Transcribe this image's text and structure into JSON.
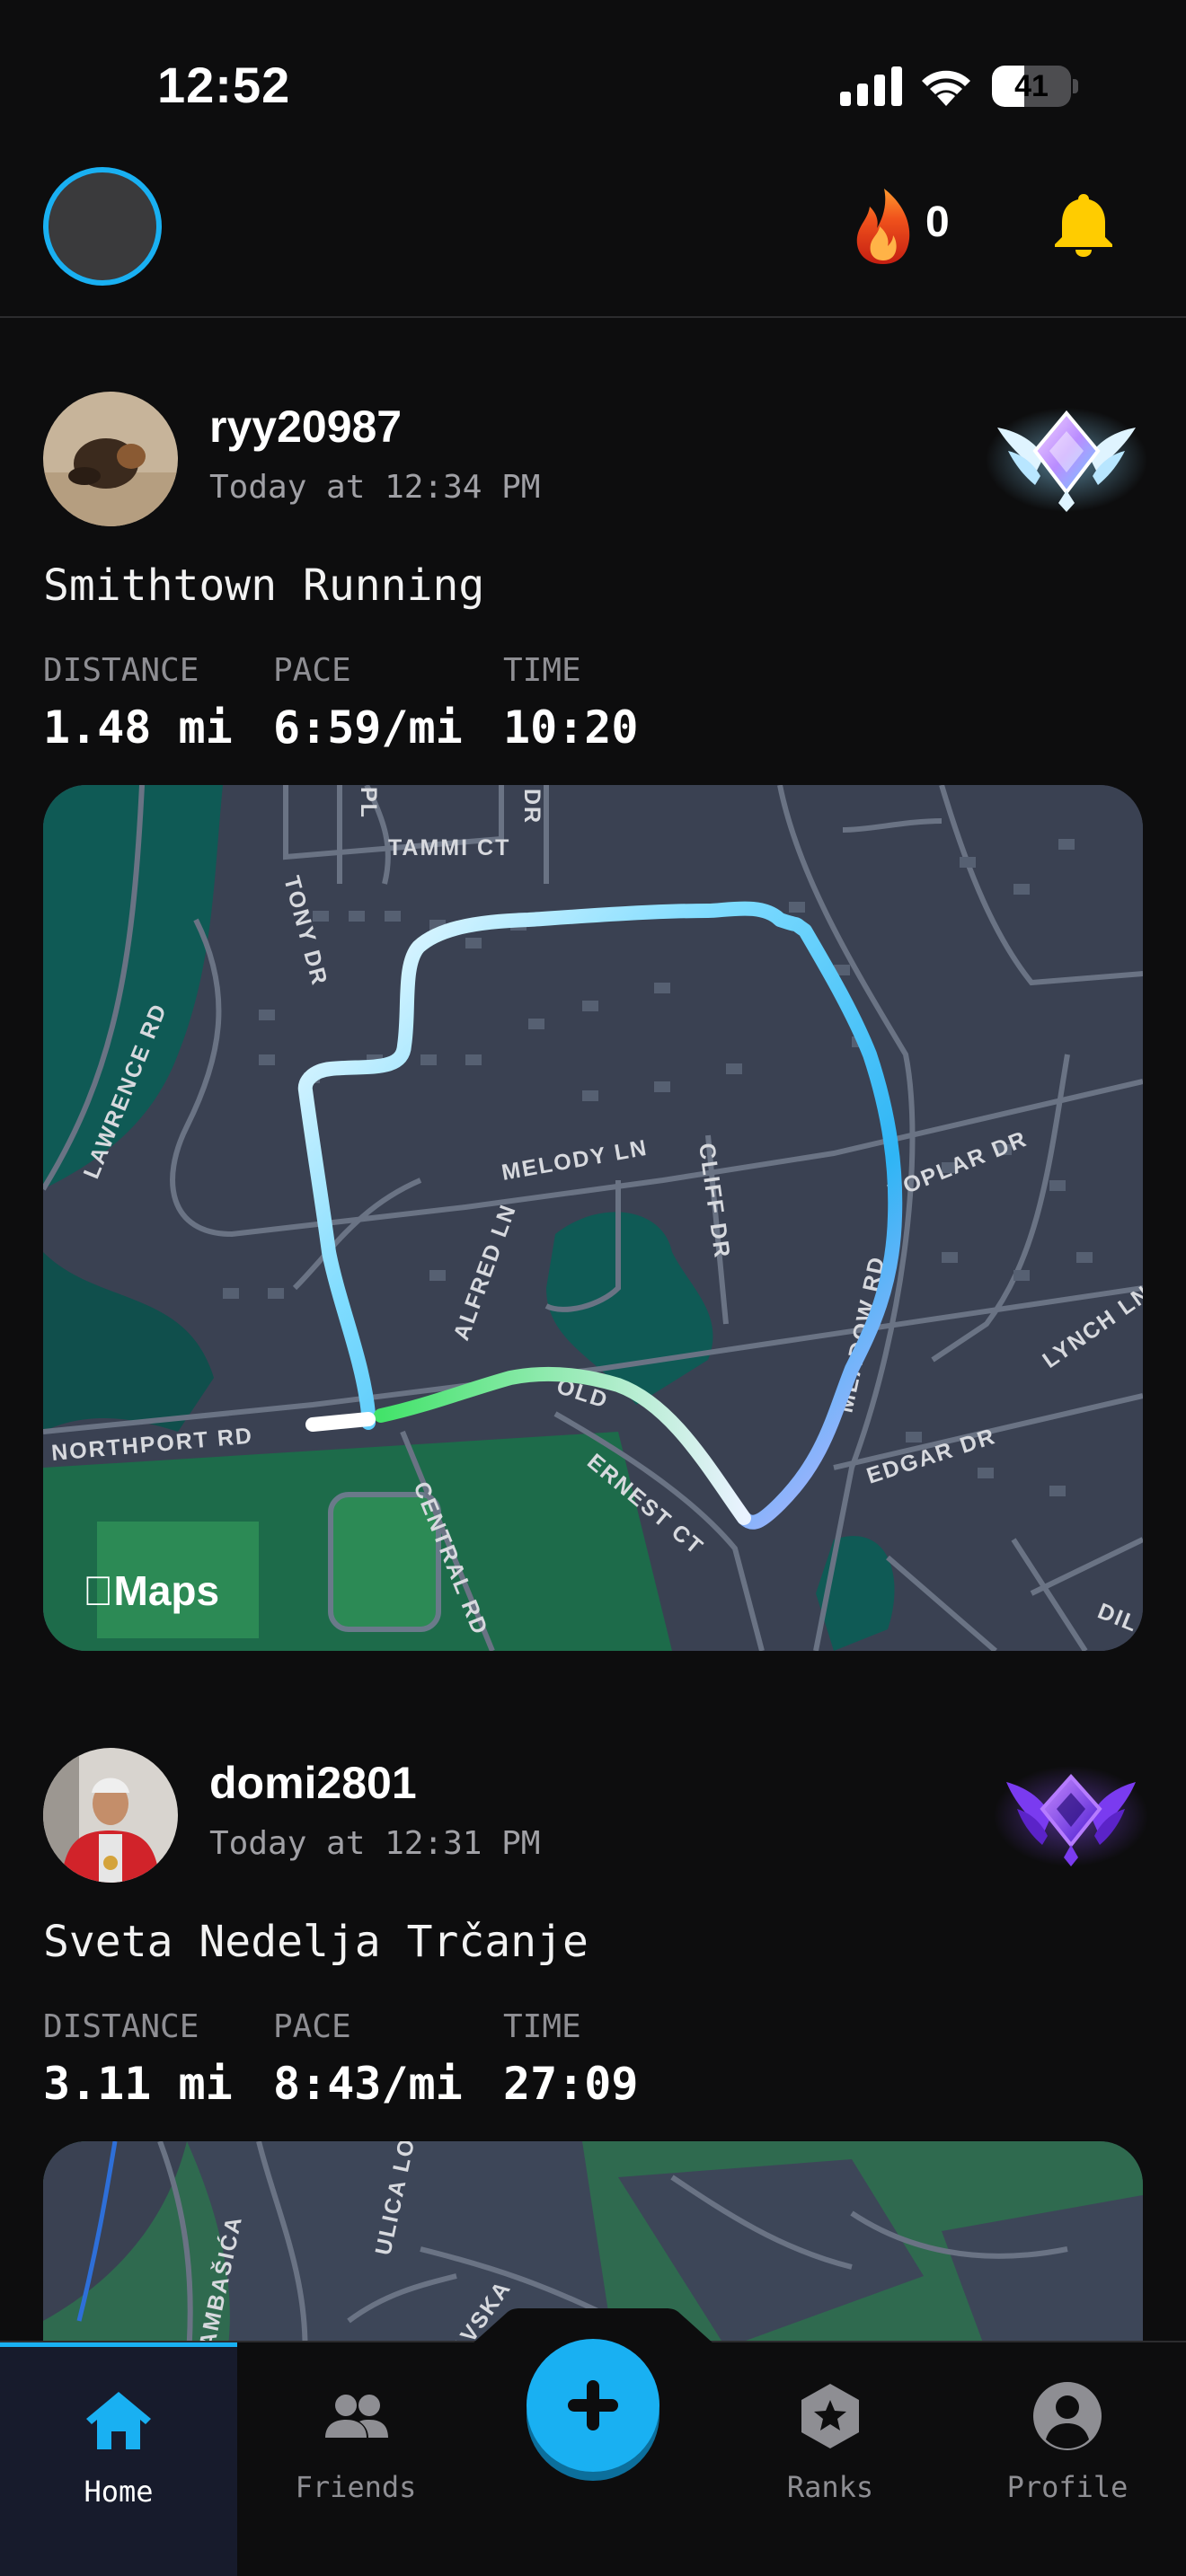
{
  "status_bar": {
    "time": "12:52",
    "battery_percent": 41,
    "battery_label": "41"
  },
  "header": {
    "streak_count": "0"
  },
  "posts": [
    {
      "username": "ryy20987",
      "timestamp": "Today at 12:34 PM",
      "title": "Smithtown Running",
      "stats": [
        {
          "label": "DISTANCE",
          "value": "1.48 mi"
        },
        {
          "label": "PACE",
          "value": "6:59/mi"
        },
        {
          "label": "TIME",
          "value": "10:20"
        }
      ],
      "map": {
        "logo": "Maps",
        "streets": [
          "TAMMI CT",
          "PL",
          "DR",
          "TONY DR",
          "LAWRENCE RD",
          "MELODY LN",
          "CLIFF DR",
          "POPLAR DR",
          "ALFRED LN",
          "MEADOW RD",
          "LYNCH LN",
          "NORTHPORT RD",
          "OLD",
          "ERNEST CT",
          "EDGAR DR",
          "CENTRAL RD",
          "DIL"
        ]
      }
    },
    {
      "username": "domi2801",
      "timestamp": "Today at 12:31 PM",
      "title": "Sveta Nedelja Trčanje",
      "stats": [
        {
          "label": "DISTANCE",
          "value": "3.11 mi"
        },
        {
          "label": "PACE",
          "value": "8:43/mi"
        },
        {
          "label": "TIME",
          "value": "27:09"
        }
      ],
      "map": {
        "streets": [
          "AMBAŠIĆA",
          "ULICA LOV",
          "SAVSKA"
        ]
      }
    }
  ],
  "tabs": [
    {
      "label": "Home",
      "icon": "home-icon",
      "active": true
    },
    {
      "label": "Friends",
      "icon": "friends-icon",
      "active": false
    },
    {
      "label": "Ranks",
      "icon": "ranks-icon",
      "active": false
    },
    {
      "label": "Profile",
      "icon": "profile-icon",
      "active": false
    }
  ],
  "colors": {
    "accent": "#19b0f2",
    "background": "#0d0d0e",
    "bell": "#ffcc00"
  }
}
